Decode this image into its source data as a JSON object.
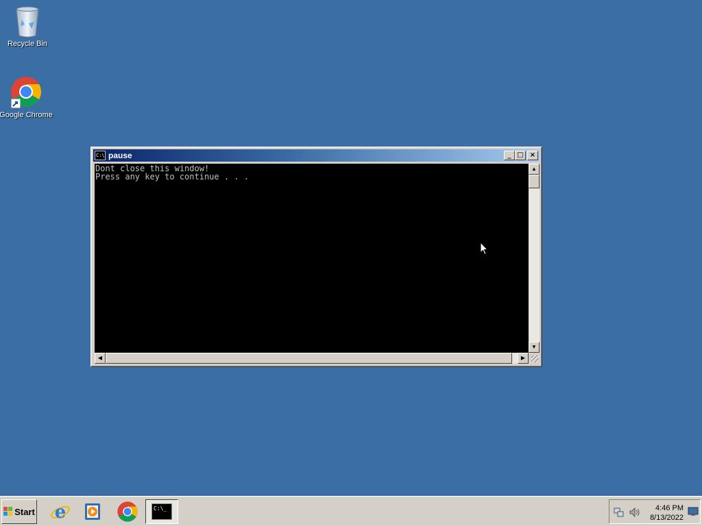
{
  "desktop": {
    "icons": [
      {
        "label": "Recycle Bin",
        "icon": "recycle-bin-icon"
      },
      {
        "label": "Google Chrome",
        "icon": "chrome-icon"
      }
    ],
    "background_color": "#3a6ea5"
  },
  "window": {
    "title": "pause",
    "icon": "console-icon",
    "icon_text": "C:\\.",
    "console_lines": [
      "Dont close this window!",
      "Press any key to continue . . ."
    ],
    "buttons": {
      "minimize": "_",
      "maximize": "□",
      "close": "×"
    }
  },
  "taskbar": {
    "start_label": "Start",
    "pinned": [
      {
        "name": "internet-explorer-icon"
      },
      {
        "name": "media-player-icon"
      },
      {
        "name": "chrome-icon"
      },
      {
        "name": "console-icon",
        "active": true,
        "text": "C:\\_"
      }
    ],
    "clock": {
      "time": "4:46 PM",
      "date": "8/13/2022"
    }
  }
}
